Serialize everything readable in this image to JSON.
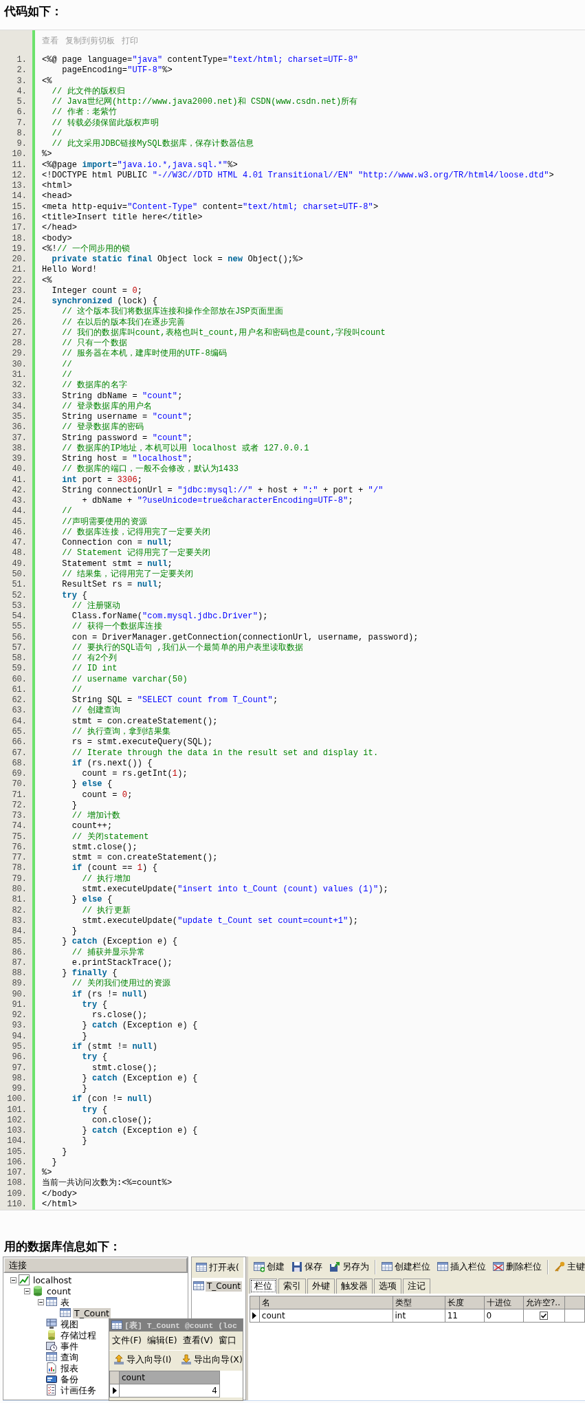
{
  "code_heading": "代码如下：",
  "code_view": {
    "toolbar": [
      "查看",
      "复制到剪切板",
      "打印"
    ],
    "lines": [
      {
        "no": "1.",
        "segs": [
          {
            "kind": "plain",
            "text": "<%@ page language="
          },
          {
            "kind": "string",
            "text": "\"java\""
          },
          {
            "kind": "plain",
            "text": " contentType="
          },
          {
            "kind": "string",
            "text": "\"text/html; charset=UTF-8\""
          }
        ]
      },
      {
        "no": "2.",
        "segs": [
          {
            "kind": "plain",
            "text": "    pageEncoding="
          },
          {
            "kind": "string",
            "text": "\"UTF-8\""
          },
          {
            "kind": "plain",
            "text": "%>"
          }
        ]
      },
      {
        "no": "3.",
        "segs": [
          {
            "kind": "plain",
            "text": "<%"
          }
        ]
      },
      {
        "no": "4.",
        "segs": [
          {
            "kind": "comment",
            "text": "  // 此文件的版权归"
          }
        ]
      },
      {
        "no": "5.",
        "segs": [
          {
            "kind": "comment",
            "text": "  // Java世纪网(http://www.java2000.net)和 CSDN(www.csdn.net)所有"
          }
        ]
      },
      {
        "no": "6.",
        "segs": [
          {
            "kind": "comment",
            "text": "  // 作者：老紫竹"
          }
        ]
      },
      {
        "no": "7.",
        "segs": [
          {
            "kind": "comment",
            "text": "  // 转载必须保留此版权声明"
          }
        ]
      },
      {
        "no": "8.",
        "segs": [
          {
            "kind": "comment",
            "text": "  //"
          }
        ]
      },
      {
        "no": "9.",
        "segs": [
          {
            "kind": "comment",
            "text": "  // 此文采用JDBC链接MySQL数据库，保存计数器信息"
          }
        ]
      },
      {
        "no": "10.",
        "segs": [
          {
            "kind": "plain",
            "text": "%>"
          }
        ]
      },
      {
        "no": "11.",
        "segs": [
          {
            "kind": "plain",
            "text": "<%@page "
          },
          {
            "kind": "keyword",
            "text": "import"
          },
          {
            "kind": "plain",
            "text": "="
          },
          {
            "kind": "string",
            "text": "\"java.io.*,java.sql.*\""
          },
          {
            "kind": "plain",
            "text": "%>"
          }
        ]
      },
      {
        "no": "12.",
        "segs": [
          {
            "kind": "plain",
            "text": "<!DOCTYPE html PUBLIC "
          },
          {
            "kind": "string",
            "text": "\"-//W3C//DTD HTML 4.01 Transitional//EN\""
          },
          {
            "kind": "string",
            "text": " \"http://www.w3.org/TR/html4/loose.dtd\""
          },
          {
            "kind": "plain",
            "text": ">"
          }
        ]
      },
      {
        "no": "13.",
        "segs": [
          {
            "kind": "plain",
            "text": "<html>"
          }
        ]
      },
      {
        "no": "14.",
        "segs": [
          {
            "kind": "plain",
            "text": "<head>"
          }
        ]
      },
      {
        "no": "15.",
        "segs": [
          {
            "kind": "plain",
            "text": "<meta http-equiv="
          },
          {
            "kind": "string",
            "text": "\"Content-Type\""
          },
          {
            "kind": "plain",
            "text": " content="
          },
          {
            "kind": "string",
            "text": "\"text/html; charset=UTF-8\""
          },
          {
            "kind": "plain",
            "text": ">"
          }
        ]
      },
      {
        "no": "16.",
        "segs": [
          {
            "kind": "plain",
            "text": "<title>Insert title here</title>"
          }
        ]
      },
      {
        "no": "17.",
        "segs": [
          {
            "kind": "plain",
            "text": "</head>"
          }
        ]
      },
      {
        "no": "18.",
        "segs": [
          {
            "kind": "plain",
            "text": "<body>"
          }
        ]
      },
      {
        "no": "19.",
        "segs": [
          {
            "kind": "plain",
            "text": "<%!"
          },
          {
            "kind": "comment",
            "text": "// 一个同步用的锁"
          }
        ]
      },
      {
        "no": "20.",
        "segs": [
          {
            "kind": "keyword",
            "text": "  private static final"
          },
          {
            "kind": "plain",
            "text": " Object lock = "
          },
          {
            "kind": "keyword",
            "text": "new"
          },
          {
            "kind": "plain",
            "text": " Object();%>"
          }
        ]
      },
      {
        "no": "21.",
        "segs": [
          {
            "kind": "plain",
            "text": "Hello Word!"
          }
        ]
      },
      {
        "no": "22.",
        "segs": [
          {
            "kind": "plain",
            "text": "<%"
          }
        ]
      },
      {
        "no": "23.",
        "segs": [
          {
            "kind": "plain",
            "text": "  Integer count = "
          },
          {
            "kind": "number",
            "text": "0"
          },
          {
            "kind": "plain",
            "text": ";"
          }
        ]
      },
      {
        "no": "24.",
        "segs": [
          {
            "kind": "keyword",
            "text": "  synchronized"
          },
          {
            "kind": "plain",
            "text": " (lock) {"
          }
        ]
      },
      {
        "no": "25.",
        "segs": [
          {
            "kind": "comment",
            "text": "    // 这个版本我们将数据库连接和操作全部放在JSP页面里面"
          }
        ]
      },
      {
        "no": "26.",
        "segs": [
          {
            "kind": "comment",
            "text": "    // 在以后的版本我们在逐步完善"
          }
        ]
      },
      {
        "no": "27.",
        "segs": [
          {
            "kind": "comment",
            "text": "    // 我们的数据库叫count,表格也叫t_count,用户名和密码也是count,字段叫count"
          }
        ]
      },
      {
        "no": "28.",
        "segs": [
          {
            "kind": "comment",
            "text": "    // 只有一个数据"
          }
        ]
      },
      {
        "no": "29.",
        "segs": [
          {
            "kind": "comment",
            "text": "    // 服务器在本机，建库时使用的UTF-8编码"
          }
        ]
      },
      {
        "no": "30.",
        "segs": [
          {
            "kind": "comment",
            "text": "    //"
          }
        ]
      },
      {
        "no": "31.",
        "segs": [
          {
            "kind": "comment",
            "text": "    //"
          }
        ]
      },
      {
        "no": "32.",
        "segs": [
          {
            "kind": "comment",
            "text": "    // 数据库的名字"
          }
        ]
      },
      {
        "no": "33.",
        "segs": [
          {
            "kind": "plain",
            "text": "    String dbName = "
          },
          {
            "kind": "string",
            "text": "\"count\""
          },
          {
            "kind": "plain",
            "text": ";"
          }
        ]
      },
      {
        "no": "34.",
        "segs": [
          {
            "kind": "comment",
            "text": "    // 登录数据库的用户名"
          }
        ]
      },
      {
        "no": "35.",
        "segs": [
          {
            "kind": "plain",
            "text": "    String username = "
          },
          {
            "kind": "string",
            "text": "\"count\""
          },
          {
            "kind": "plain",
            "text": ";"
          }
        ]
      },
      {
        "no": "36.",
        "segs": [
          {
            "kind": "comment",
            "text": "    // 登录数据库的密码"
          }
        ]
      },
      {
        "no": "37.",
        "segs": [
          {
            "kind": "plain",
            "text": "    String password = "
          },
          {
            "kind": "string",
            "text": "\"count\""
          },
          {
            "kind": "plain",
            "text": ";"
          }
        ]
      },
      {
        "no": "38.",
        "segs": [
          {
            "kind": "comment",
            "text": "    // 数据库的IP地址，本机可以用 localhost 或者 127.0.0.1"
          }
        ]
      },
      {
        "no": "39.",
        "segs": [
          {
            "kind": "plain",
            "text": "    String host = "
          },
          {
            "kind": "string",
            "text": "\"localhost\""
          },
          {
            "kind": "plain",
            "text": ";"
          }
        ]
      },
      {
        "no": "40.",
        "segs": [
          {
            "kind": "comment",
            "text": "    // 数据库的端口，一般不会修改，默认为1433"
          }
        ]
      },
      {
        "no": "41.",
        "segs": [
          {
            "kind": "keyword",
            "text": "    int"
          },
          {
            "kind": "plain",
            "text": " port = "
          },
          {
            "kind": "number",
            "text": "3306"
          },
          {
            "kind": "plain",
            "text": ";"
          }
        ]
      },
      {
        "no": "42.",
        "segs": [
          {
            "kind": "plain",
            "text": "    String connectionUrl = "
          },
          {
            "kind": "string",
            "text": "\"jdbc:mysql://\""
          },
          {
            "kind": "plain",
            "text": " + host + "
          },
          {
            "kind": "string",
            "text": "\":\""
          },
          {
            "kind": "plain",
            "text": " + port + "
          },
          {
            "kind": "string",
            "text": "\"/\""
          }
        ]
      },
      {
        "no": "43.",
        "segs": [
          {
            "kind": "plain",
            "text": "        + dbName + "
          },
          {
            "kind": "string",
            "text": "\"?useUnicode=true&characterEncoding=UTF-8\""
          },
          {
            "kind": "plain",
            "text": ";"
          }
        ]
      },
      {
        "no": "44.",
        "segs": [
          {
            "kind": "comment",
            "text": "    //"
          }
        ]
      },
      {
        "no": "45.",
        "segs": [
          {
            "kind": "comment",
            "text": "    //声明需要使用的资源"
          }
        ]
      },
      {
        "no": "46.",
        "segs": [
          {
            "kind": "comment",
            "text": "    // 数据库连接，记得用完了一定要关闭"
          }
        ]
      },
      {
        "no": "47.",
        "segs": [
          {
            "kind": "plain",
            "text": "    Connection con = "
          },
          {
            "kind": "keyword",
            "text": "null"
          },
          {
            "kind": "plain",
            "text": ";"
          }
        ]
      },
      {
        "no": "48.",
        "segs": [
          {
            "kind": "comment",
            "text": "    // Statement 记得用完了一定要关闭"
          }
        ]
      },
      {
        "no": "49.",
        "segs": [
          {
            "kind": "plain",
            "text": "    Statement stmt = "
          },
          {
            "kind": "keyword",
            "text": "null"
          },
          {
            "kind": "plain",
            "text": ";"
          }
        ]
      },
      {
        "no": "50.",
        "segs": [
          {
            "kind": "comment",
            "text": "    // 结果集，记得用完了一定要关闭"
          }
        ]
      },
      {
        "no": "51.",
        "segs": [
          {
            "kind": "plain",
            "text": "    ResultSet rs = "
          },
          {
            "kind": "keyword",
            "text": "null"
          },
          {
            "kind": "plain",
            "text": ";"
          }
        ]
      },
      {
        "no": "52.",
        "segs": [
          {
            "kind": "keyword",
            "text": "    try"
          },
          {
            "kind": "plain",
            "text": " {"
          }
        ]
      },
      {
        "no": "53.",
        "segs": [
          {
            "kind": "comment",
            "text": "      // 注册驱动"
          }
        ]
      },
      {
        "no": "54.",
        "segs": [
          {
            "kind": "plain",
            "text": "      Class.forName("
          },
          {
            "kind": "string",
            "text": "\"com.mysql.jdbc.Driver\""
          },
          {
            "kind": "plain",
            "text": ");"
          }
        ]
      },
      {
        "no": "55.",
        "segs": [
          {
            "kind": "comment",
            "text": "      // 获得一个数据库连接"
          }
        ]
      },
      {
        "no": "56.",
        "segs": [
          {
            "kind": "plain",
            "text": "      con = DriverManager.getConnection(connectionUrl, username, password);"
          }
        ]
      },
      {
        "no": "57.",
        "segs": [
          {
            "kind": "comment",
            "text": "      // 要执行的SQL语句 ,我们从一个最简单的用户表里读取数据"
          }
        ]
      },
      {
        "no": "58.",
        "segs": [
          {
            "kind": "comment",
            "text": "      // 有2个列"
          }
        ]
      },
      {
        "no": "59.",
        "segs": [
          {
            "kind": "comment",
            "text": "      // ID int"
          }
        ]
      },
      {
        "no": "60.",
        "segs": [
          {
            "kind": "comment",
            "text": "      // username varchar(50)"
          }
        ]
      },
      {
        "no": "61.",
        "segs": [
          {
            "kind": "comment",
            "text": "      //"
          }
        ]
      },
      {
        "no": "62.",
        "segs": [
          {
            "kind": "plain",
            "text": "      String SQL = "
          },
          {
            "kind": "string",
            "text": "\"SELECT count from T_Count\""
          },
          {
            "kind": "plain",
            "text": ";"
          }
        ]
      },
      {
        "no": "63.",
        "segs": [
          {
            "kind": "comment",
            "text": "      // 创建查询"
          }
        ]
      },
      {
        "no": "64.",
        "segs": [
          {
            "kind": "plain",
            "text": "      stmt = con.createStatement();"
          }
        ]
      },
      {
        "no": "65.",
        "segs": [
          {
            "kind": "comment",
            "text": "      // 执行查询，拿到结果集"
          }
        ]
      },
      {
        "no": "66.",
        "segs": [
          {
            "kind": "plain",
            "text": "      rs = stmt.executeQuery(SQL);"
          }
        ]
      },
      {
        "no": "67.",
        "segs": [
          {
            "kind": "comment",
            "text": "      // Iterate through the data in the result set and display it."
          }
        ]
      },
      {
        "no": "68.",
        "segs": [
          {
            "kind": "keyword",
            "text": "      if"
          },
          {
            "kind": "plain",
            "text": " (rs.next()) {"
          }
        ]
      },
      {
        "no": "69.",
        "segs": [
          {
            "kind": "plain",
            "text": "        count = rs.getInt("
          },
          {
            "kind": "number",
            "text": "1"
          },
          {
            "kind": "plain",
            "text": ");"
          }
        ]
      },
      {
        "no": "70.",
        "segs": [
          {
            "kind": "plain",
            "text": "      } "
          },
          {
            "kind": "keyword",
            "text": "else"
          },
          {
            "kind": "plain",
            "text": " {"
          }
        ]
      },
      {
        "no": "71.",
        "segs": [
          {
            "kind": "plain",
            "text": "        count = "
          },
          {
            "kind": "number",
            "text": "0"
          },
          {
            "kind": "plain",
            "text": ";"
          }
        ]
      },
      {
        "no": "72.",
        "segs": [
          {
            "kind": "plain",
            "text": "      }"
          }
        ]
      },
      {
        "no": "73.",
        "segs": [
          {
            "kind": "comment",
            "text": "      // 增加计数"
          }
        ]
      },
      {
        "no": "74.",
        "segs": [
          {
            "kind": "plain",
            "text": "      count++;"
          }
        ]
      },
      {
        "no": "75.",
        "segs": [
          {
            "kind": "comment",
            "text": "      // 关闭statement"
          }
        ]
      },
      {
        "no": "76.",
        "segs": [
          {
            "kind": "plain",
            "text": "      stmt.close();"
          }
        ]
      },
      {
        "no": "77.",
        "segs": [
          {
            "kind": "plain",
            "text": "      stmt = con.createStatement();"
          }
        ]
      },
      {
        "no": "78.",
        "segs": [
          {
            "kind": "keyword",
            "text": "      if"
          },
          {
            "kind": "plain",
            "text": " (count == "
          },
          {
            "kind": "number",
            "text": "1"
          },
          {
            "kind": "plain",
            "text": ") {"
          }
        ]
      },
      {
        "no": "79.",
        "segs": [
          {
            "kind": "comment",
            "text": "        // 执行增加"
          }
        ]
      },
      {
        "no": "80.",
        "segs": [
          {
            "kind": "plain",
            "text": "        stmt.executeUpdate("
          },
          {
            "kind": "string",
            "text": "\"insert into t_Count (count) values (1)\""
          },
          {
            "kind": "plain",
            "text": ");"
          }
        ]
      },
      {
        "no": "81.",
        "segs": [
          {
            "kind": "plain",
            "text": "      } "
          },
          {
            "kind": "keyword",
            "text": "else"
          },
          {
            "kind": "plain",
            "text": " {"
          }
        ]
      },
      {
        "no": "82.",
        "segs": [
          {
            "kind": "comment",
            "text": "        // 执行更新"
          }
        ]
      },
      {
        "no": "83.",
        "segs": [
          {
            "kind": "plain",
            "text": "        stmt.executeUpdate("
          },
          {
            "kind": "string",
            "text": "\"update t_Count set count=count+1\""
          },
          {
            "kind": "plain",
            "text": ");"
          }
        ]
      },
      {
        "no": "84.",
        "segs": [
          {
            "kind": "plain",
            "text": "      }"
          }
        ]
      },
      {
        "no": "85.",
        "segs": [
          {
            "kind": "plain",
            "text": "    } "
          },
          {
            "kind": "keyword",
            "text": "catch"
          },
          {
            "kind": "plain",
            "text": " (Exception e) {"
          }
        ]
      },
      {
        "no": "86.",
        "segs": [
          {
            "kind": "comment",
            "text": "      // 捕获并显示异常"
          }
        ]
      },
      {
        "no": "87.",
        "segs": [
          {
            "kind": "plain",
            "text": "      e.printStackTrace();"
          }
        ]
      },
      {
        "no": "88.",
        "segs": [
          {
            "kind": "plain",
            "text": "    } "
          },
          {
            "kind": "keyword",
            "text": "finally"
          },
          {
            "kind": "plain",
            "text": " {"
          }
        ]
      },
      {
        "no": "89.",
        "segs": [
          {
            "kind": "comment",
            "text": "      // 关闭我们使用过的资源"
          }
        ]
      },
      {
        "no": "90.",
        "segs": [
          {
            "kind": "keyword",
            "text": "      if"
          },
          {
            "kind": "plain",
            "text": " (rs != "
          },
          {
            "kind": "keyword",
            "text": "null"
          },
          {
            "kind": "plain",
            "text": ")"
          }
        ]
      },
      {
        "no": "91.",
        "segs": [
          {
            "kind": "keyword",
            "text": "        try"
          },
          {
            "kind": "plain",
            "text": " {"
          }
        ]
      },
      {
        "no": "92.",
        "segs": [
          {
            "kind": "plain",
            "text": "          rs.close();"
          }
        ]
      },
      {
        "no": "93.",
        "segs": [
          {
            "kind": "plain",
            "text": "        } "
          },
          {
            "kind": "keyword",
            "text": "catch"
          },
          {
            "kind": "plain",
            "text": " (Exception e) {"
          }
        ]
      },
      {
        "no": "94.",
        "segs": [
          {
            "kind": "plain",
            "text": "        }"
          }
        ]
      },
      {
        "no": "95.",
        "segs": [
          {
            "kind": "keyword",
            "text": "      if"
          },
          {
            "kind": "plain",
            "text": " (stmt != "
          },
          {
            "kind": "keyword",
            "text": "null"
          },
          {
            "kind": "plain",
            "text": ")"
          }
        ]
      },
      {
        "no": "96.",
        "segs": [
          {
            "kind": "keyword",
            "text": "        try"
          },
          {
            "kind": "plain",
            "text": " {"
          }
        ]
      },
      {
        "no": "97.",
        "segs": [
          {
            "kind": "plain",
            "text": "          stmt.close();"
          }
        ]
      },
      {
        "no": "98.",
        "segs": [
          {
            "kind": "plain",
            "text": "        } "
          },
          {
            "kind": "keyword",
            "text": "catch"
          },
          {
            "kind": "plain",
            "text": " (Exception e) {"
          }
        ]
      },
      {
        "no": "99.",
        "segs": [
          {
            "kind": "plain",
            "text": "        }"
          }
        ]
      },
      {
        "no": "100.",
        "segs": [
          {
            "kind": "keyword",
            "text": "      if"
          },
          {
            "kind": "plain",
            "text": " (con != "
          },
          {
            "kind": "keyword",
            "text": "null"
          },
          {
            "kind": "plain",
            "text": ")"
          }
        ]
      },
      {
        "no": "101.",
        "segs": [
          {
            "kind": "keyword",
            "text": "        try"
          },
          {
            "kind": "plain",
            "text": " {"
          }
        ]
      },
      {
        "no": "102.",
        "segs": [
          {
            "kind": "plain",
            "text": "          con.close();"
          }
        ]
      },
      {
        "no": "103.",
        "segs": [
          {
            "kind": "plain",
            "text": "        } "
          },
          {
            "kind": "keyword",
            "text": "catch"
          },
          {
            "kind": "plain",
            "text": " (Exception e) {"
          }
        ]
      },
      {
        "no": "104.",
        "segs": [
          {
            "kind": "plain",
            "text": "        }"
          }
        ]
      },
      {
        "no": "105.",
        "segs": [
          {
            "kind": "plain",
            "text": "    }"
          }
        ]
      },
      {
        "no": "106.",
        "segs": [
          {
            "kind": "plain",
            "text": "  }"
          }
        ]
      },
      {
        "no": "107.",
        "segs": [
          {
            "kind": "plain",
            "text": "%>"
          }
        ]
      },
      {
        "no": "108.",
        "segs": [
          {
            "kind": "plain",
            "text": "当前一共访问次数为:<%=count%>"
          }
        ]
      },
      {
        "no": "109.",
        "segs": [
          {
            "kind": "plain",
            "text": "</body>"
          }
        ]
      },
      {
        "no": "110.",
        "segs": [
          {
            "kind": "plain",
            "text": "</html>"
          }
        ]
      }
    ]
  },
  "db_heading": "用的数据库信息如下：",
  "navicat": {
    "connections": {
      "title": "连接",
      "tree": [
        {
          "label": "localhost",
          "kind": "server",
          "expanded": true,
          "selected": false,
          "children": [
            {
              "label": "count",
              "kind": "database",
              "expanded": true,
              "selected": false,
              "children": [
                {
                  "label": "表",
                  "kind": "tables",
                  "expanded": true,
                  "selected": false,
                  "children": [
                    {
                      "label": "T_Count",
                      "kind": "table",
                      "selected": true
                    }
                  ]
                },
                {
                  "label": "视图",
                  "kind": "views",
                  "selected": false
                },
                {
                  "label": "存储过程",
                  "kind": "procedures",
                  "selected": false
                },
                {
                  "label": "事件",
                  "kind": "events",
                  "selected": false
                },
                {
                  "label": "查询",
                  "kind": "queries",
                  "selected": false
                },
                {
                  "label": "报表",
                  "kind": "reports",
                  "selected": false
                },
                {
                  "label": "备份",
                  "kind": "backup",
                  "selected": false
                },
                {
                  "label": "计画任务",
                  "kind": "schedule",
                  "selected": false
                }
              ]
            }
          ]
        }
      ]
    },
    "objects": {
      "button": "打开表(",
      "items": [
        {
          "label": "T_Count",
          "selected": true
        }
      ]
    },
    "designer": {
      "toolbar": [
        [
          {
            "label": "创建",
            "kind": "create"
          },
          {
            "label": "保存",
            "kind": "save"
          },
          {
            "label": "另存为",
            "kind": "save_as"
          }
        ],
        [
          {
            "label": "创建栏位",
            "kind": "create_field"
          },
          {
            "label": "插入栏位",
            "kind": "insert_field"
          },
          {
            "label": "删除栏位",
            "kind": "delete_field"
          }
        ],
        [
          {
            "label": "主键",
            "kind": "primary_key"
          }
        ]
      ],
      "tabs": [
        {
          "label": "栏位",
          "selected": true
        },
        {
          "label": "索引",
          "selected": false
        },
        {
          "label": "外键",
          "selected": false
        },
        {
          "label": "触发器",
          "selected": false
        },
        {
          "label": "选项",
          "selected": false
        },
        {
          "label": "注记",
          "selected": false
        }
      ],
      "columns": [
        "名",
        "类型",
        "长度",
        "十进位",
        "允许空?.."
      ],
      "rows": [
        {
          "cells": [
            "count",
            "int",
            "11",
            "0"
          ],
          "allow_null": true,
          "selected": true
        }
      ]
    },
    "table_window": {
      "title": "[表] T_Count @count (loc",
      "menu": [
        "文件(F)",
        "编辑(E)",
        "查看(V)",
        "窗口"
      ],
      "toolbar": [
        {
          "label": "导入向导(I)",
          "kind": "import"
        },
        {
          "label": "导出向导(X)",
          "kind": "export"
        }
      ],
      "columns": [
        "count"
      ],
      "rows": [
        {
          "cells": [
            "4"
          ],
          "selected": true
        }
      ]
    }
  }
}
